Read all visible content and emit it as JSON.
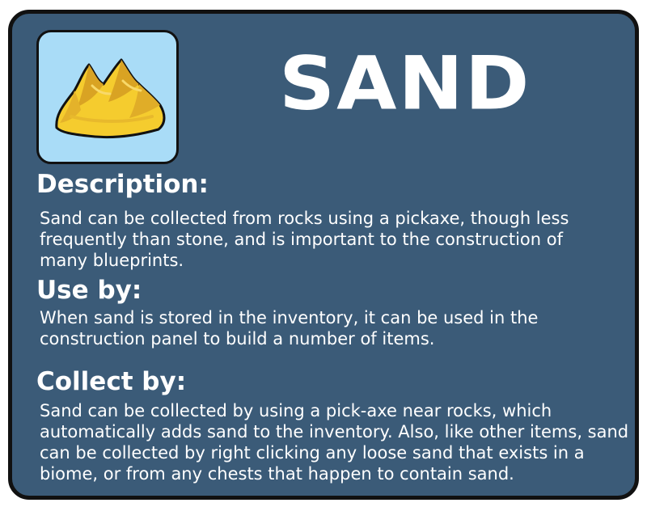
{
  "item": {
    "title": "SAND",
    "icon": "sand-pile-icon",
    "colors": {
      "card_background": "#3b5b78",
      "icon_background": "#a9dcf7",
      "sand_light": "#f5cc2e",
      "sand_dark": "#d9a323",
      "border": "#111111",
      "text": "#ffffff"
    }
  },
  "sections": {
    "description": {
      "heading": "Description:",
      "text": "Sand can be collected from rocks using a pickaxe, though less frequently than stone, and is important to the construction of many blueprints."
    },
    "use_by": {
      "heading": "Use by:",
      "text": "When sand is stored in the inventory, it can be used in the construction panel to build a number of items."
    },
    "collect_by": {
      "heading": "Collect by:",
      "text": "Sand can be collected by using a pick-axe near rocks, which automatically adds sand to the inventory. Also, like other items, sand can be collected by right clicking any loose sand that exists in a biome, or from any chests that happen to contain sand."
    }
  }
}
